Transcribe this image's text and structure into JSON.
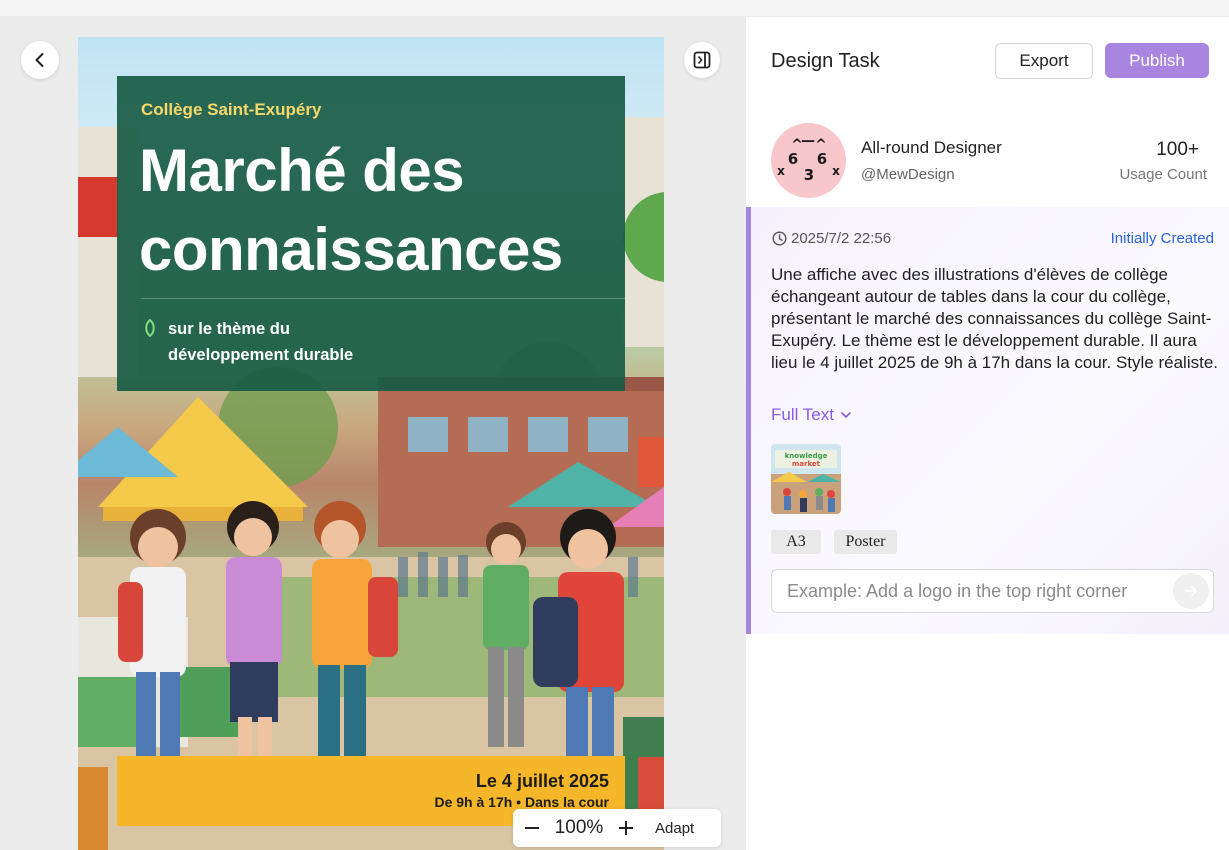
{
  "canvas": {
    "zoom": "100%",
    "adapt_label": "Adapt"
  },
  "poster": {
    "school": "Collège Saint-Exupéry",
    "title_line1": "Marché des",
    "title_line2": "connaissances",
    "subtitle_line1": "sur le thème du",
    "subtitle_line2": "développement durable",
    "date_main": "Le 4 juillet 2025",
    "date_sub": "De 9h à 17h • Dans la cour"
  },
  "panel": {
    "title": "Design Task",
    "export_label": "Export",
    "publish_label": "Publish",
    "designer": {
      "name": "All-round Designer",
      "handle": "@MewDesign",
      "usage_count": "100+",
      "usage_label": "Usage Count"
    },
    "task": {
      "timestamp": "2025/7/2 22:56",
      "status": "Initially Created",
      "prompt": "Une affiche avec des illustrations d'élèves de collège échangeant autour de tables dans la cour du collège, présentant le marché des connaissances du collège Saint-Exupéry. Le thème est le développement durable. Il aura lieu le 4 juillet 2025 de 9h à 17h dans la cour. Style réaliste.",
      "full_text_label": "Full Text",
      "tags": [
        "A3",
        "Poster"
      ],
      "input_placeholder": "Example: Add a logo in the top right corner"
    }
  },
  "colors": {
    "accent": "#a785e0",
    "link": "#2962d9",
    "poster_title_bg": "#1a5c46",
    "poster_date_bg": "#f6b62a"
  }
}
